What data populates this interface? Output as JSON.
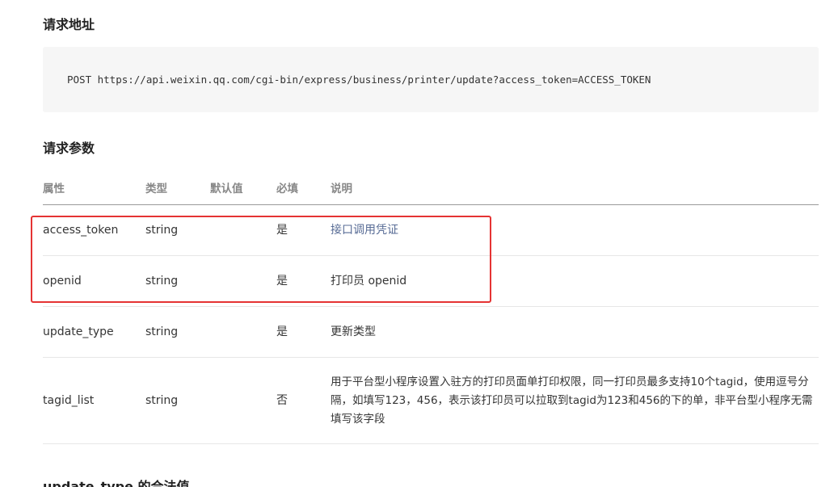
{
  "section_request_url": {
    "title": "请求地址",
    "code": "POST https://api.weixin.qq.com/cgi-bin/express/business/printer/update?access_token=ACCESS_TOKEN"
  },
  "section_request_params": {
    "title": "请求参数",
    "headers": {
      "attr": "属性",
      "type": "类型",
      "default": "默认值",
      "required": "必填",
      "desc": "说明"
    },
    "rows": [
      {
        "attr": "access_token",
        "type": "string",
        "default": "",
        "required": "是",
        "desc": "接口调用凭证"
      },
      {
        "attr": "openid",
        "type": "string",
        "default": "",
        "required": "是",
        "desc": "打印员 openid"
      },
      {
        "attr": "update_type",
        "type": "string",
        "default": "",
        "required": "是",
        "desc": "更新类型"
      },
      {
        "attr": "tagid_list",
        "type": "string",
        "default": "",
        "required": "否",
        "desc": "用于平台型小程序设置入驻方的打印员面单打印权限，同一打印员最多支持10个tagid，使用逗号分隔，如填写123，456，表示该打印员可以拉取到tagid为123和456的下的单，非平台型小程序无需填写该字段"
      }
    ]
  },
  "section_bottom": {
    "title": "update_type 的合法值"
  },
  "colors": {
    "highlight_border": "#e53333",
    "link": "#576b95",
    "code_bg": "#f6f6f6"
  }
}
